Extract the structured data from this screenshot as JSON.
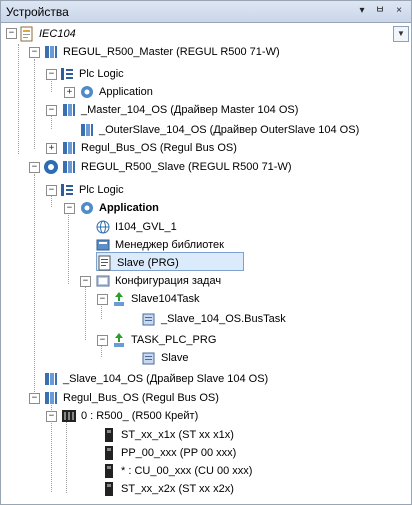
{
  "panel": {
    "title": "Устройства"
  },
  "titlebar_buttons": {
    "dropdown": "▾",
    "pin": "ㅂ",
    "close": "×"
  },
  "tree": {
    "root": "IEC104",
    "master_device": "REGUL_R500_Master (REGUL R500 71-W)",
    "master_plc_logic": "Plc Logic",
    "master_application": "Application",
    "master_104": "_Master_104_OS (Драйвер Master 104 OS)",
    "outer_slave": "_OuterSlave_104_OS (Драйвер OuterSlave 104 OS)",
    "master_bus": "Regul_Bus_OS (Regul Bus OS)",
    "slave_device": "REGUL_R500_Slave (REGUL R500 71-W)",
    "slave_plc_logic": "Plc Logic",
    "slave_application": "Application",
    "gvl": "I104_GVL_1",
    "lib_manager": "Менеджер библиотек",
    "slave_prg": "Slave (PRG)",
    "task_config": "Конфигурация задач",
    "task1": "Slave104Task",
    "task1_item": "_Slave_104_OS.BusTask",
    "task2": "TASK_PLC_PRG",
    "task2_item": "Slave",
    "slave_104": "_Slave_104_OS (Драйвер Slave 104 OS)",
    "slave_bus": "Regul_Bus_OS (Regul Bus OS)",
    "crate": "0 : R500_ (R500 Крейт)",
    "mod1": "ST_xx_x1x (ST xx x1x)",
    "mod2": "PP_00_xxx (PP 00 xxx)",
    "mod3": "* : CU_00_xxx (CU 00 xxx)",
    "mod4": "ST_xx_x2x (ST xx x2x)"
  },
  "colors": {
    "selection": "#dcebfc",
    "selection_border": "#7da2ce"
  }
}
